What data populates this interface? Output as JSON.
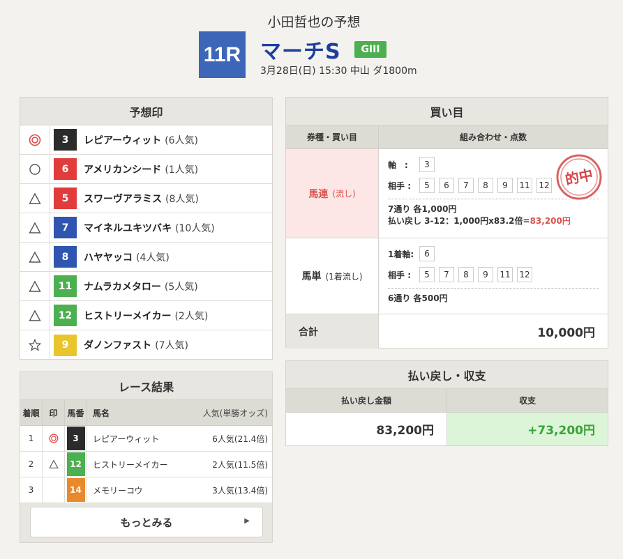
{
  "header": {
    "subtitle": "小田哲也の予想",
    "race_no": "11R",
    "race_name": "マーチS",
    "grade": "GIII",
    "race_info": "3月28日(日) 15:30 中山 ダ1800m"
  },
  "prediction": {
    "title": "予想印",
    "rows": [
      {
        "mark": "double-circle",
        "num": "3",
        "color": "#2b2b2b",
        "name": "レピアーウィット",
        "pop": "(6人気)"
      },
      {
        "mark": "circle",
        "num": "6",
        "color": "#e03c3c",
        "name": "アメリカンシード",
        "pop": "(1人気)"
      },
      {
        "mark": "triangle",
        "num": "5",
        "color": "#e03c3c",
        "name": "スワーヴアラミス",
        "pop": "(8人気)"
      },
      {
        "mark": "triangle",
        "num": "7",
        "color": "#2f55b0",
        "name": "マイネルユキツバキ",
        "pop": "(10人気)"
      },
      {
        "mark": "triangle",
        "num": "8",
        "color": "#2f55b0",
        "name": "ハヤヤッコ",
        "pop": "(4人気)"
      },
      {
        "mark": "triangle",
        "num": "11",
        "color": "#4caf50",
        "name": "ナムラカメタロー",
        "pop": "(5人気)"
      },
      {
        "mark": "triangle",
        "num": "12",
        "color": "#4caf50",
        "name": "ヒストリーメイカー",
        "pop": "(2人気)"
      },
      {
        "mark": "star",
        "num": "9",
        "color": "#e8c52c",
        "name": "ダノンファスト",
        "pop": "(7人気)"
      }
    ]
  },
  "results": {
    "title": "レース結果",
    "headers": {
      "rank": "着順",
      "mark": "印",
      "num": "馬番",
      "name": "馬名",
      "pop": "人気(単勝オッズ)"
    },
    "rows": [
      {
        "rank": "1",
        "mark": "double-circle",
        "num": "3",
        "color": "#2b2b2b",
        "name": "レピアーウィット",
        "pop": "6人気(21.4倍)"
      },
      {
        "rank": "2",
        "mark": "triangle",
        "num": "12",
        "color": "#4caf50",
        "name": "ヒストリーメイカー",
        "pop": "2人気(11.5倍)"
      },
      {
        "rank": "3",
        "mark": "",
        "num": "14",
        "color": "#e8892c",
        "name": "メモリーコウ",
        "pop": "3人気(13.4倍)"
      }
    ],
    "more_label": "もっとみる"
  },
  "buy": {
    "title": "買い目",
    "head_left": "券種・買い目",
    "head_right": "組み合わせ・点数",
    "bet1": {
      "type": "馬連",
      "sub": "(流し)",
      "axis_label": "軸",
      "axis": [
        "3"
      ],
      "partner_label": "相手",
      "partners": [
        "5",
        "6",
        "7",
        "8",
        "9",
        "11",
        "12"
      ],
      "note1": "7通り 各1,000円",
      "note2_prefix": "払い戻し 3-12：1,000円x83.2倍=",
      "note2_amount": "83,200円",
      "stamp": "的中"
    },
    "bet2": {
      "type": "馬単",
      "sub": "(1着流し)",
      "axis_label": "1着軸",
      "axis": [
        "6"
      ],
      "partner_label": "相手",
      "partners": [
        "5",
        "7",
        "8",
        "9",
        "11",
        "12"
      ],
      "note1": "6通り 各500円"
    },
    "total_label": "合計",
    "total_value": "10,000円"
  },
  "payout": {
    "title": "払い戻し・収支",
    "head_left": "払い戻し金額",
    "head_right": "収支",
    "amount": "83,200円",
    "profit": "+73,200円"
  }
}
